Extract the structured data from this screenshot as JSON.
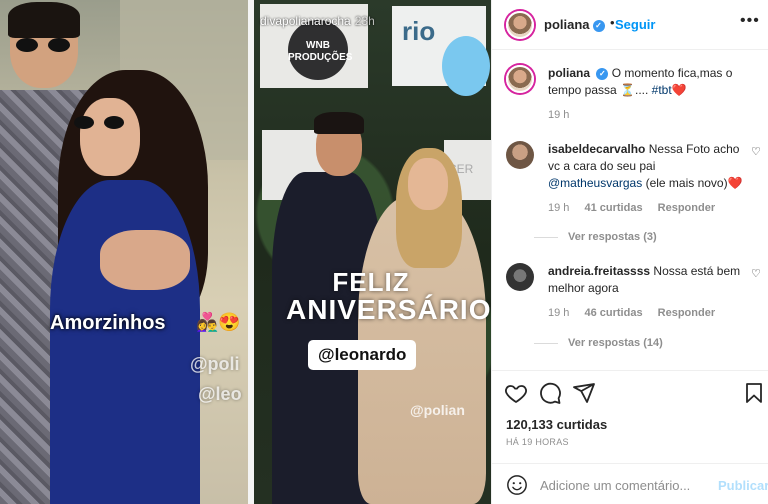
{
  "story_left": {
    "sticker_text": "Amorzinhos",
    "sticker_emoji": "👩‍❤️‍👨😍",
    "mention_1": "@poli",
    "mention_2": "@leo"
  },
  "story_right": {
    "username": "divapolianarocha",
    "time": "23h",
    "board_logo": "WNB\nPRODUÇÕES",
    "board2_text": "rio",
    "board4_text": "CER",
    "feliz_line1": "FELIZ",
    "feliz_line2": "ANIVERSÁRIO!",
    "leo_tag": "@leonardo",
    "pol_tag": "@polian"
  },
  "header": {
    "username": "poliana",
    "verified": "✓",
    "dot": "•",
    "follow_label": "Seguir",
    "more_label": "•••"
  },
  "caption": {
    "username": "poliana",
    "text": "O momento fica,mas o tempo passa ⏳.... ",
    "hashtag": "#tbt",
    "emoji": "❤️",
    "time": "19 h"
  },
  "comments": [
    {
      "username": "isabeldecarvalho",
      "text": "Nessa Foto acho vc a cara do seu pai ",
      "mention": "@matheusvargas",
      "text_after": " (ele mais novo)❤️",
      "time": "19 h",
      "likes": "41 curtidas",
      "reply_label": "Responder",
      "view_replies": "Ver respostas (3)"
    },
    {
      "username": "andreia.freitassss",
      "text": "Nossa está bem melhor agora",
      "time": "19 h",
      "likes": "46 curtidas",
      "reply_label": "Responder",
      "view_replies": "Ver respostas (14)"
    }
  ],
  "actions": {
    "like_icon": "heart-icon",
    "comment_icon": "comment-icon",
    "share_icon": "share-icon",
    "save_icon": "bookmark-icon",
    "likes_text": "120,133 curtidas",
    "ago_text": "HÁ 19 HORAS"
  },
  "add_comment": {
    "placeholder": "Adicione um comentário...",
    "publish_label": "Publicar"
  },
  "colors": {
    "accent": "#0095f6",
    "publish_disabled": "#b2dffc",
    "text": "#262626",
    "muted": "#8e8e8e"
  }
}
